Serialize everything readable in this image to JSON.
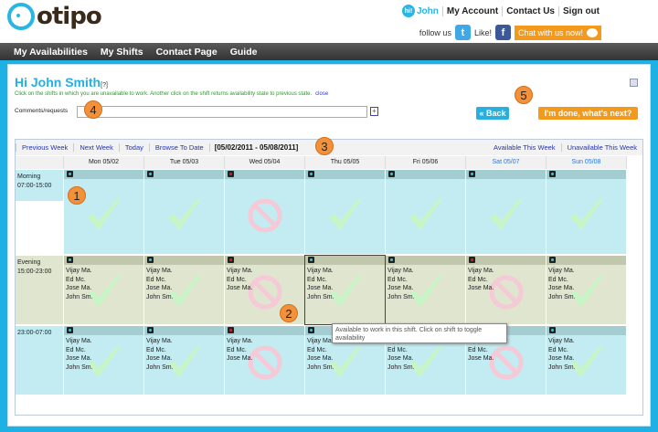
{
  "header": {
    "logo_text": "otipo",
    "hi_badge": "hi!",
    "user": "John",
    "links": [
      "My Account",
      "Contact Us",
      "Sign out"
    ],
    "follow": "follow us",
    "like": "Like!",
    "chat": "Chat with us now!"
  },
  "nav": [
    "My Availabilities",
    "My Shifts",
    "Contact Page",
    "Guide"
  ],
  "page": {
    "title": "Hi John Smith",
    "help": "[?]",
    "instructions": "Click on the shifts in which you are unavailable to work. Another click on the shift returns availability state to previous state.",
    "close": "close",
    "comments_label": "Comments/requests",
    "comments_value": "",
    "back": "« Back",
    "done": "I'm done, what's next?"
  },
  "toolbar": {
    "prev": "Previous Week",
    "next": "Next Week",
    "today": "Today",
    "browse": "Browse To Date",
    "range": "[05/02/2011 - 05/08/2011]",
    "available": "Available This Week",
    "unavailable": "Unavailable This Week"
  },
  "days": [
    {
      "label": "Mon 05/02",
      "weekend": false
    },
    {
      "label": "Tue 05/03",
      "weekend": false
    },
    {
      "label": "Wed 05/04",
      "weekend": false
    },
    {
      "label": "Thu 05/05",
      "weekend": false
    },
    {
      "label": "Fri 05/06",
      "weekend": false
    },
    {
      "label": "Sat 05/07",
      "weekend": true
    },
    {
      "label": "Sun 05/08",
      "weekend": true
    }
  ],
  "colors": {
    "available": "#33c7ef",
    "unavailable": "#e8141c",
    "accent": "#29aee0",
    "orange": "#f39a1c"
  },
  "shifts": [
    {
      "name": "Morning",
      "time": "07:00-15:00",
      "bg": "#c2ecf1",
      "bar": "#a4cdd2",
      "cells": [
        {
          "status": "available",
          "names": []
        },
        {
          "status": "available",
          "names": []
        },
        {
          "status": "unavailable",
          "names": []
        },
        {
          "status": "available",
          "names": []
        },
        {
          "status": "available",
          "names": []
        },
        {
          "status": "available",
          "names": []
        },
        {
          "status": "available",
          "names": []
        }
      ]
    },
    {
      "name": "Evening",
      "time": "15:00-23:00",
      "bg": "#dfe5cf",
      "bar": "#c0c7ad",
      "cells": [
        {
          "status": "available",
          "names": [
            "Vijay Ma.",
            "Ed Mc.",
            "Jose Ma.",
            "John Sm."
          ]
        },
        {
          "status": "available",
          "names": [
            "Vijay Ma.",
            "Ed Mc.",
            "Jose Ma.",
            "John Sm."
          ]
        },
        {
          "status": "unavailable",
          "names": [
            "Vijay Ma.",
            "Ed Mc.",
            "Jose Ma."
          ]
        },
        {
          "status": "available",
          "names": [
            "Vijay Ma.",
            "Ed Mc.",
            "Jose Ma.",
            "John Sm."
          ],
          "selected": true
        },
        {
          "status": "available",
          "names": [
            "Vijay Ma.",
            "Ed Mc.",
            "Jose Ma.",
            "John Sm."
          ]
        },
        {
          "status": "unavailable",
          "names": [
            "Vijay Ma.",
            "Ed Mc.",
            "Jose Ma."
          ]
        },
        {
          "status": "available",
          "names": [
            "Vijay Ma.",
            "Ed Mc.",
            "Jose Ma.",
            "John Sm."
          ]
        }
      ]
    },
    {
      "name": "",
      "time": "23:00-07:00",
      "bg": "#c2ecf1",
      "bar": "#a4cdd2",
      "cells": [
        {
          "status": "available",
          "names": [
            "Vijay Ma.",
            "Ed Mc.",
            "Jose Ma.",
            "John Sm."
          ]
        },
        {
          "status": "available",
          "names": [
            "Vijay Ma.",
            "Ed Mc.",
            "Jose Ma.",
            "John Sm."
          ]
        },
        {
          "status": "unavailable",
          "names": [
            "Vijay Ma.",
            "Ed Mc.",
            "Jose Ma."
          ]
        },
        {
          "status": "available",
          "names": [
            "Vijay Ma.",
            "Ed Mc.",
            "Jose Ma.",
            "John Sm."
          ]
        },
        {
          "status": "available",
          "names": [
            "Vijay Ma.",
            "Ed Mc.",
            "Jose Ma.",
            "John Sm."
          ]
        },
        {
          "status": "unavailable",
          "names": [
            "Vijay Ma.",
            "Ed Mc.",
            "Jose Ma."
          ]
        },
        {
          "status": "available",
          "names": [
            "Vijay Ma.",
            "Ed Mc.",
            "Jose Ma.",
            "John Sm."
          ]
        }
      ]
    }
  ],
  "tooltip": "Available to work in this shift. Click on shift to toggle availability",
  "annotations": [
    "1",
    "2",
    "3",
    "4",
    "5"
  ]
}
